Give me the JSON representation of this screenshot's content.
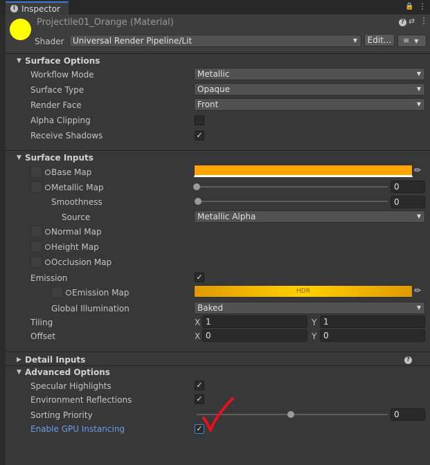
{
  "tab": {
    "icon": "info-icon",
    "label": "Inspector"
  },
  "header": {
    "material_name": "Projectile01_Orange (Material)",
    "shader_label": "Shader",
    "shader_value": "Universal Render Pipeline/Lit",
    "edit_label": "Edit...",
    "preview_color": "#ffff00"
  },
  "surface_options": {
    "title": "Surface Options",
    "workflow_mode": {
      "label": "Workflow Mode",
      "value": "Metallic"
    },
    "surface_type": {
      "label": "Surface Type",
      "value": "Opaque"
    },
    "render_face": {
      "label": "Render Face",
      "value": "Front"
    },
    "alpha_clipping": {
      "label": "Alpha Clipping",
      "checked": false
    },
    "receive_shadows": {
      "label": "Receive Shadows",
      "checked": true
    }
  },
  "surface_inputs": {
    "title": "Surface Inputs",
    "base_map": {
      "label": "Base Map",
      "color": "#ffa500"
    },
    "metallic_map": {
      "label": "Metallic Map",
      "value": "0",
      "level": 0
    },
    "smoothness": {
      "label": "Smoothness",
      "value": "0",
      "level": 0
    },
    "source": {
      "label": "Source",
      "value": "Metallic Alpha"
    },
    "normal_map": {
      "label": "Normal Map"
    },
    "height_map": {
      "label": "Height Map"
    },
    "occlusion_map": {
      "label": "Occlusion Map"
    },
    "emission": {
      "label": "Emission",
      "checked": true
    },
    "emission_map": {
      "label": "Emission Map",
      "hdr_label": "HDR",
      "color": "#ffc400"
    },
    "global_illumination": {
      "label": "Global Illumination",
      "value": "Baked"
    },
    "tiling": {
      "label": "Tiling",
      "x_label": "X",
      "x": "1",
      "y_label": "Y",
      "y": "1"
    },
    "offset": {
      "label": "Offset",
      "x_label": "X",
      "x": "0",
      "y_label": "Y",
      "y": "0"
    }
  },
  "detail_inputs": {
    "title": "Detail Inputs"
  },
  "advanced_options": {
    "title": "Advanced Options",
    "specular_highlights": {
      "label": "Specular Highlights",
      "checked": true
    },
    "environment_reflections": {
      "label": "Environment Reflections",
      "checked": true
    },
    "sorting_priority": {
      "label": "Sorting Priority",
      "value": "0",
      "level": 0.5
    },
    "gpu_instancing": {
      "label": "Enable GPU Instancing",
      "checked": true
    },
    "link_color": "#6a9ee8",
    "annotation_color": "#e8101a"
  }
}
